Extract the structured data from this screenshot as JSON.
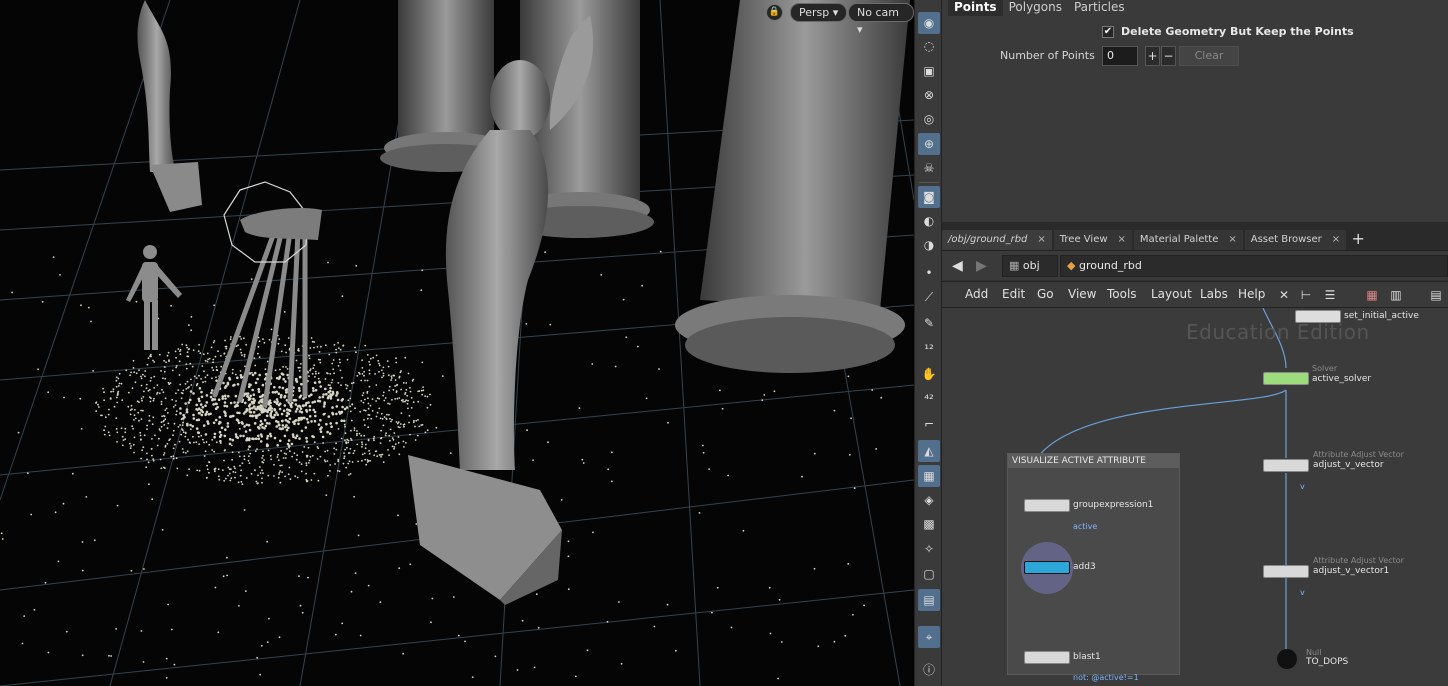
{
  "viewport": {
    "lock_icon": "lock-icon",
    "camera_persp": "Persp",
    "camera_cam": "No cam"
  },
  "params": {
    "tabs": [
      "Points",
      "Polygons",
      "Particles"
    ],
    "active_tab": "Points",
    "delete_geometry_label": "Delete Geometry But Keep the Points",
    "delete_geometry_checked": true,
    "number_of_points_label": "Number of Points",
    "number_of_points_value": "0",
    "plus_label": "+",
    "minus_label": "−",
    "clear_label": "Clear"
  },
  "network_tabs": [
    {
      "label": "/obj/ground_rbd",
      "close": "×"
    },
    {
      "label": "Tree View",
      "close": "×"
    },
    {
      "label": "Material Palette",
      "close": "×"
    },
    {
      "label": "Asset Browser",
      "close": "×"
    }
  ],
  "add_tab_label": "+",
  "path": {
    "obj": "obj",
    "node": "ground_rbd"
  },
  "menu": [
    "Add",
    "Edit",
    "Go",
    "View",
    "Tools",
    "Layout",
    "Labs",
    "Help"
  ],
  "network": {
    "watermark": "Education Edition",
    "box_title": "VISUALIZE ACTIVE ATTRIBUTE",
    "nodes": [
      {
        "name": "set_initial_active",
        "type": ""
      },
      {
        "name": "active_solver",
        "type": "Solver"
      },
      {
        "name": "adjust_v_vector",
        "type": "Attribute Adjust Vector",
        "sub": "v"
      },
      {
        "name": "adjust_v_vector1",
        "type": "Attribute Adjust Vector",
        "sub": "v"
      },
      {
        "name": "TO_DOPS",
        "type": "Null"
      },
      {
        "name": "groupexpression1",
        "sub": "active"
      },
      {
        "name": "add3"
      },
      {
        "name": "blast1",
        "sub": "not: @active!=1"
      }
    ]
  }
}
